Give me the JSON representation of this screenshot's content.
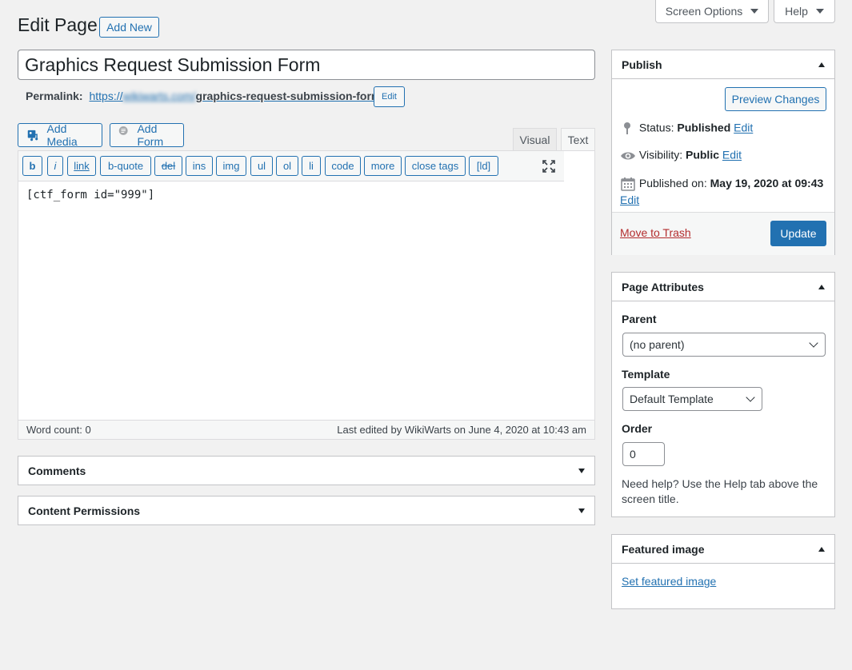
{
  "screen_meta": {
    "screen_options": "Screen Options",
    "help": "Help"
  },
  "header": {
    "title": "Edit Page",
    "add_new": "Add New"
  },
  "post": {
    "title": "Graphics Request Submission Form",
    "permalink_label": "Permalink:",
    "permalink_prefix": "https://",
    "permalink_domain": "wikiwarts.com/",
    "permalink_slug": "graphics-request-submission-form/",
    "permalink_edit": "Edit"
  },
  "media": {
    "add_media": "Add Media",
    "add_form": "Add Form"
  },
  "editor": {
    "tabs": {
      "visual": "Visual",
      "text": "Text"
    },
    "quicktags": [
      "b",
      "i",
      "link",
      "b-quote",
      "del",
      "ins",
      "img",
      "ul",
      "ol",
      "li",
      "code",
      "more",
      "close tags",
      "[ld]"
    ],
    "content": "[ctf_form id=\"999\"]",
    "word_count": "Word count: 0",
    "last_edited": "Last edited by WikiWarts on June 4, 2020 at 10:43 am"
  },
  "boxes": {
    "comments": "Comments",
    "content_permissions": "Content Permissions"
  },
  "publish": {
    "heading": "Publish",
    "preview": "Preview Changes",
    "status_label": "Status:",
    "status_value": "Published",
    "visibility_label": "Visibility:",
    "visibility_value": "Public",
    "published_label": "Published on:",
    "published_value": "May 19, 2020 at 09:43",
    "edit": "Edit",
    "trash": "Move to Trash",
    "update": "Update"
  },
  "page_attributes": {
    "heading": "Page Attributes",
    "parent_label": "Parent",
    "parent_value": "(no parent)",
    "template_label": "Template",
    "template_value": "Default Template",
    "order_label": "Order",
    "order_value": "0",
    "help_text": "Need help? Use the Help tab above the screen title."
  },
  "featured_image": {
    "heading": "Featured image",
    "link": "Set featured image"
  },
  "colors": {
    "accent": "#2271b1",
    "primary_button": "#2271b1",
    "trash": "#b32d2e",
    "background": "#f1f1f1"
  }
}
